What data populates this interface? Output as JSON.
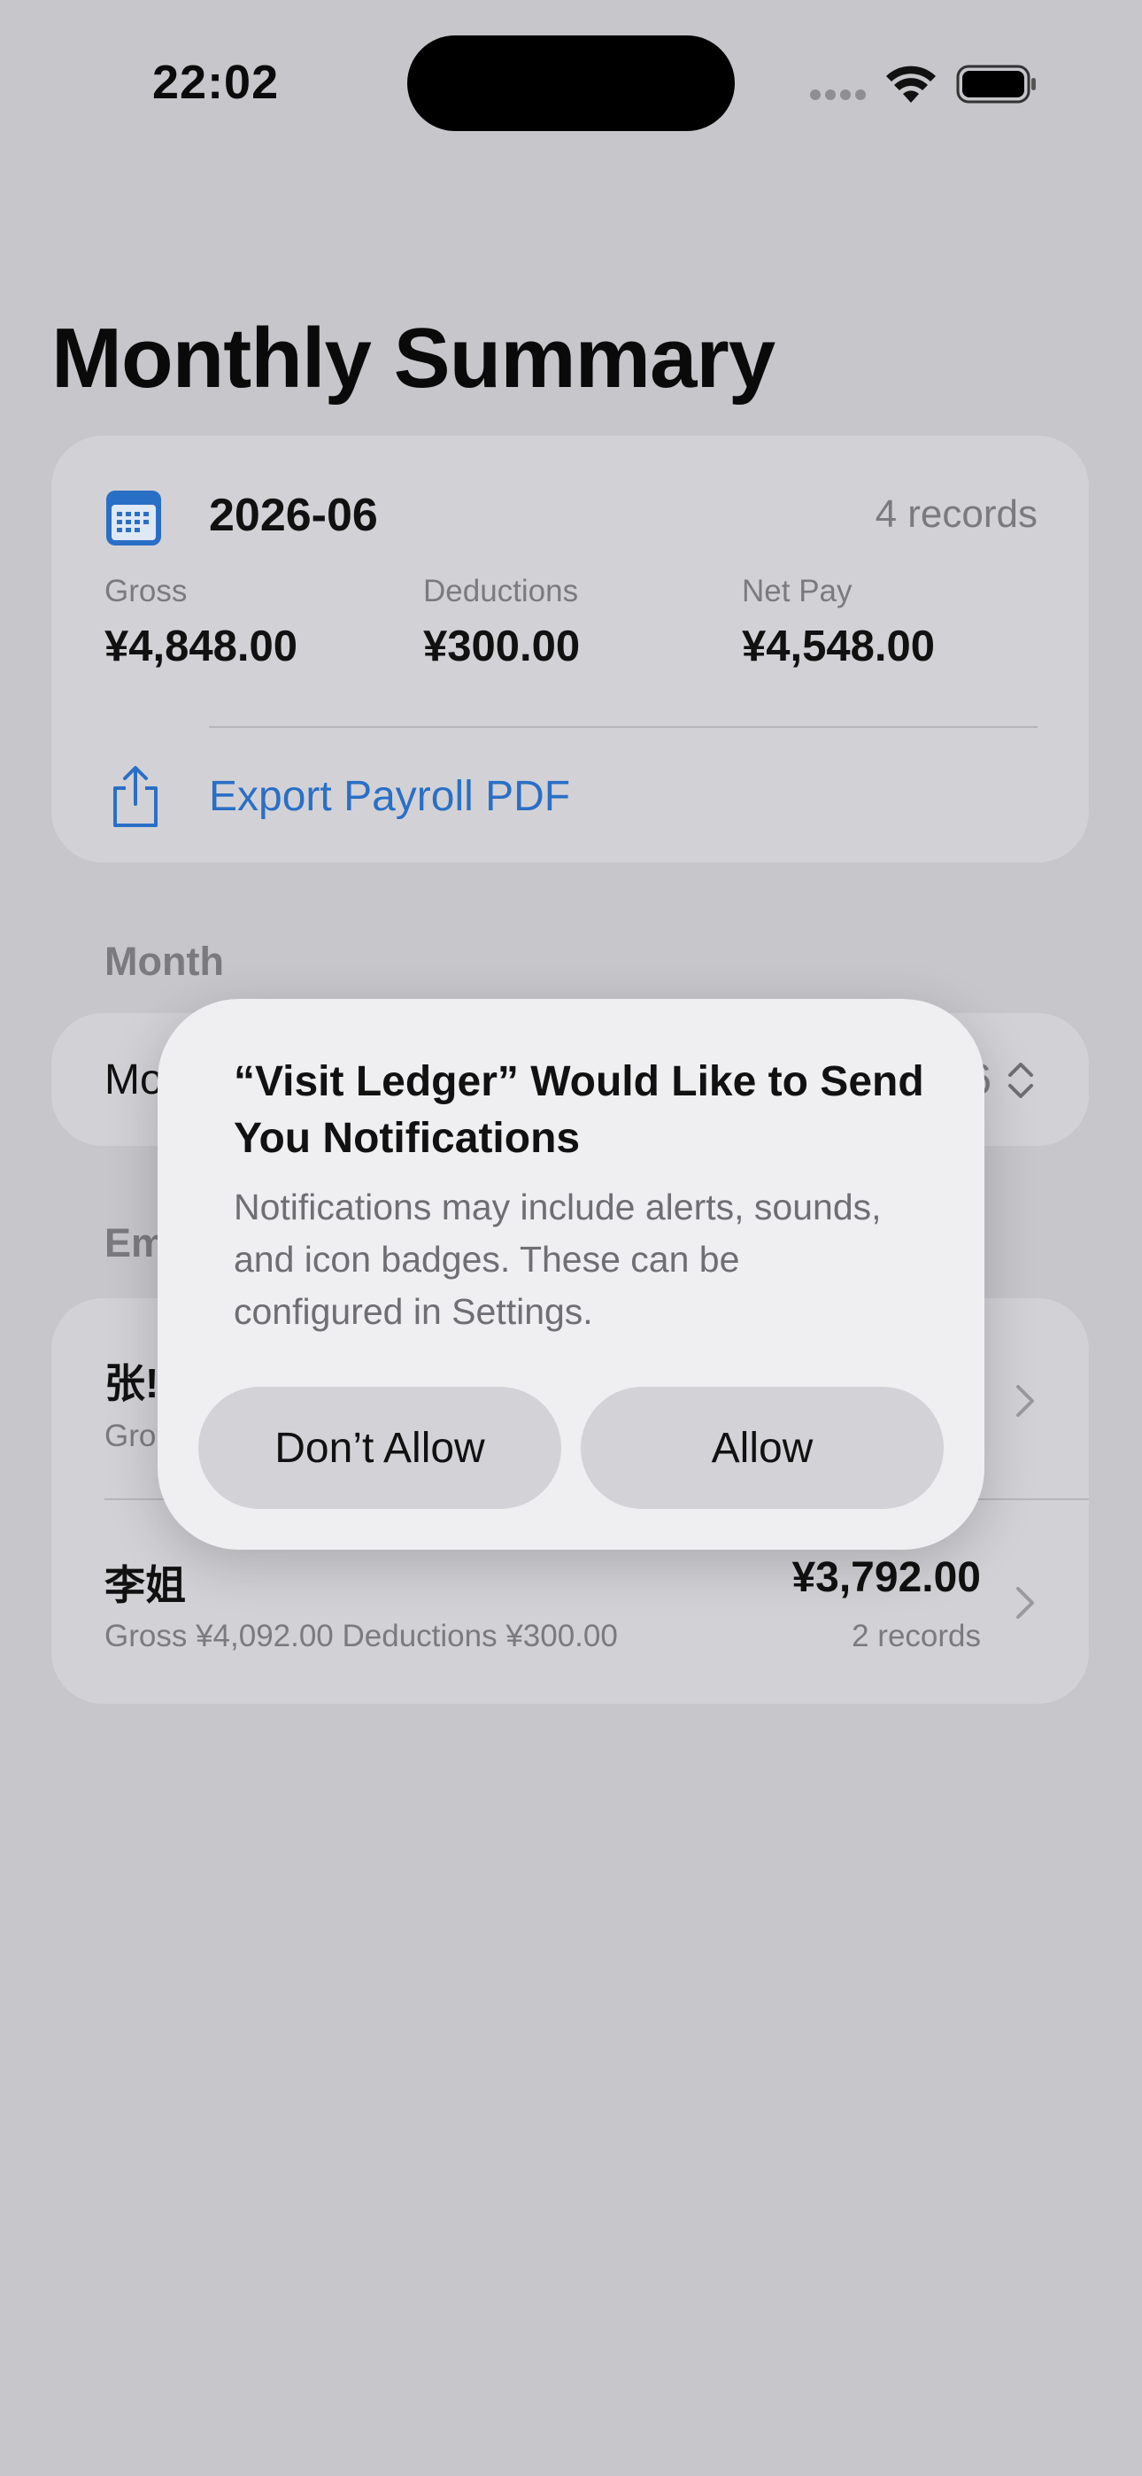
{
  "status_bar": {
    "time": "22:02"
  },
  "page": {
    "title": "Monthly Summary"
  },
  "summary": {
    "month": "2026-06",
    "records": "4 records",
    "gross_label": "Gross",
    "gross_value": "¥4,848.00",
    "deductions_label": "Deductions",
    "deductions_value": "¥300.00",
    "net_label": "Net Pay",
    "net_value": "¥4,548.00",
    "export_label": "Export Payroll PDF"
  },
  "month_section": {
    "header": "Month",
    "row_label": "Mo",
    "row_value": "6"
  },
  "employees_section": {
    "header": "Em",
    "items": [
      {
        "name": "张!",
        "detail": "Gro",
        "amount": "",
        "records": ""
      },
      {
        "name": "李姐",
        "detail": "Gross ¥4,092.00   Deductions ¥300.00",
        "amount": "¥3,792.00",
        "records": "2 records"
      }
    ]
  },
  "dialog": {
    "title": "“Visit Ledger” Would Like to Send You Notifications",
    "message": "Notifications may include alerts, sounds, and icon badges. These can be configured in Settings.",
    "dont_allow": "Don’t Allow",
    "allow": "Allow"
  },
  "colors": {
    "accent": "#2a6fc6",
    "background": "#c6c6cb",
    "card": "#d2d2d6",
    "dialog": "#efeff1"
  }
}
